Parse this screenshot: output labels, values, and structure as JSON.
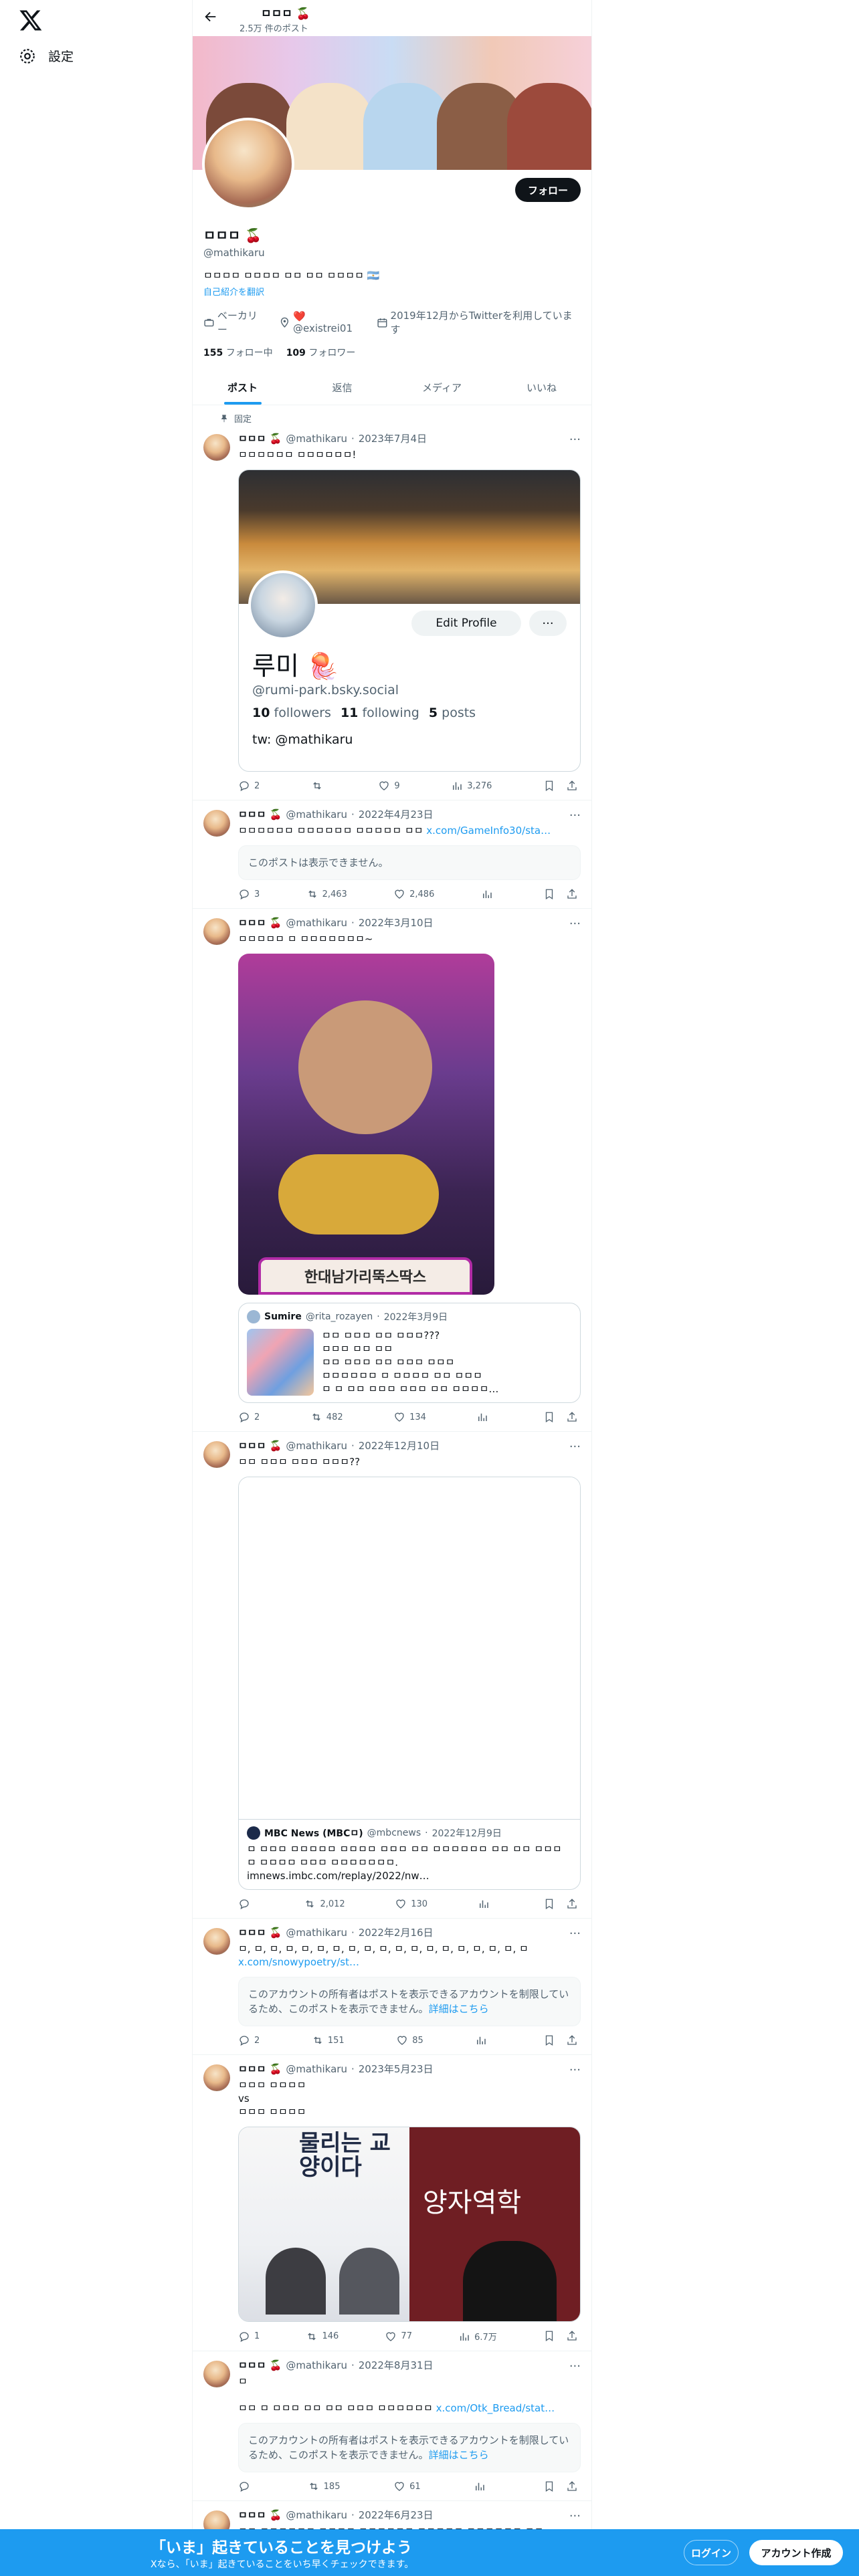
{
  "nav": {
    "settings_label": "設定"
  },
  "header": {
    "name": "ㅁㅁㅁ 🍒",
    "post_count": "2.5万 件のポスト"
  },
  "profile": {
    "name": "ㅁㅁㅁ 🍒",
    "handle": "@mathikaru",
    "bio": "ㅁㅁㅁㅁ ㅁㅁㅁㅁ ㅁㅁ ㅁㅁ ㅁㅁㅁㅁ 🇦🇷",
    "translate": "自己紹介を翻訳",
    "location": "ベーカリー",
    "link": "❤️@existrei01",
    "joined": "2019年12月からTwitterを利用しています",
    "following_count": "155",
    "following_label": "フォロー中",
    "followers_count": "109",
    "followers_label": "フォロワー",
    "follow_button": "フォロー"
  },
  "tabs": [
    "ポスト",
    "返信",
    "メディア",
    "いいね"
  ],
  "pinned_label": "固定",
  "tweets": [
    {
      "name": "ㅁㅁㅁ 🍒",
      "handle": "@mathikaru",
      "date": "2023年7月4日",
      "text": "ㅁㅁㅁㅁㅁㅁ ㅁㅁㅁㅁㅁㅁ!",
      "card": {
        "button": "Edit Profile",
        "name": "루미 🪼",
        "handle": "@rumi-park.bsky.social",
        "followers": "10",
        "followers_label": "followers",
        "following": "11",
        "following_label": "following",
        "posts": "5",
        "posts_label": "posts",
        "bio": "tw: @mathikaru"
      },
      "replies": "2",
      "retweets": "",
      "likes": "9",
      "views": "3,276"
    },
    {
      "name": "ㅁㅁㅁ 🍒",
      "handle": "@mathikaru",
      "date": "2022年4月23日",
      "text": "ㅁㅁㅁㅁㅁㅁ ㅁㅁㅁㅁㅁㅁ ㅁㅁㅁㅁㅁ ㅁㅁ ",
      "link": "x.com/GameInfo30/sta…",
      "unavailable": "このポストは表示できません。",
      "replies": "3",
      "retweets": "2,463",
      "likes": "2,486",
      "views": ""
    },
    {
      "name": "ㅁㅁㅁ 🍒",
      "handle": "@mathikaru",
      "date": "2022年3月10日",
      "text": "ㅁㅁㅁㅁㅁ ㅁ ㅁㅁㅁㅁㅁㅁㅁ~",
      "image_caption": "한대남가리뚝스딱스",
      "quote": {
        "name": "Sumire",
        "handle": "@rita_rozayen",
        "date": "2022年3月9日",
        "text": "ㅁㅁ ㅁㅁㅁ ㅁㅁ ㅁㅁㅁ???\nㅁㅁㅁ ㅁㅁ ㅁㅁ\nㅁㅁ ㅁㅁㅁ ㅁㅁ ㅁㅁㅁ ㅁㅁㅁ\nㅁㅁㅁㅁㅁㅁ ㅁ ㅁㅁㅁㅁ ㅁㅁ ㅁㅁㅁ\nㅁ ㅁ ㅁㅁ ㅁㅁㅁ ㅁㅁㅁ ㅁㅁ ㅁㅁㅁㅁ…"
      },
      "replies": "2",
      "retweets": "482",
      "likes": "134",
      "views": ""
    },
    {
      "name": "ㅁㅁㅁ 🍒",
      "handle": "@mathikaru",
      "date": "2022年12月10日",
      "text": "ㅁㅁ ㅁㅁㅁ ㅁㅁㅁ ㅁㅁㅁ??",
      "quote": {
        "name": "MBC News (MBCㅁ)",
        "handle": "@mbcnews",
        "date": "2022年12月9日",
        "text": "ㅁ ㅁㅁㅁ ㅁㅁㅁㅁㅁ ㅁㅁㅁㅁ ㅁㅁㅁ ㅁㅁ ㅁㅁㅁㅁㅁㅁ ㅁㅁ ㅁㅁ ㅁㅁㅁ\nㅁ ㅁㅁㅁㅁ ㅁㅁㅁ ㅁㅁㅁㅁㅁㅁㅁ.\nimnews.imbc.com/replay/2022/nw…"
      },
      "replies": "",
      "retweets": "2,012",
      "likes": "130",
      "views": ""
    },
    {
      "name": "ㅁㅁㅁ 🍒",
      "handle": "@mathikaru",
      "date": "2022年2月16日",
      "text": "ㅁ, ㅁ, ㅁ, ㅁ, ㅁ, ㅁ, ㅁ, ㅁ, ㅁ, ㅁ, ㅁ, ㅁ, ㅁ, ㅁ, ㅁ, ㅁ, ㅁ, ㅁ, ㅁ",
      "link": "x.com/snowypoetry/st…",
      "unavailable": "このアカウントの所有者はポストを表示できるアカウントを制限しているため、このポストを表示できません。",
      "detail_link": "詳細はこちら",
      "replies": "2",
      "retweets": "151",
      "likes": "85",
      "views": ""
    },
    {
      "name": "ㅁㅁㅁ 🍒",
      "handle": "@mathikaru",
      "date": "2023年5月23日",
      "text": "ㅁㅁㅁ ㅁㅁㅁㅁ\nvs\nㅁㅁㅁ ㅁㅁㅁㅁ",
      "img_left": "물리는 교양이다",
      "img_right": "양자역학",
      "replies": "1",
      "retweets": "146",
      "likes": "77",
      "views": "6.7万"
    },
    {
      "name": "ㅁㅁㅁ 🍒",
      "handle": "@mathikaru",
      "date": "2022年8月31日",
      "text": "ㅁ\n\nㅁㅁ ㅁ ㅁㅁㅁ ㅁㅁ ㅁㅁ ㅁㅁㅁ ㅁㅁㅁㅁㅁㅁ ",
      "link": "x.com/Otk_Bread/stat…",
      "unavailable": "このアカウントの所有者はポストを表示できるアカウントを制限しているため、このポストを表示できません。",
      "detail_link": "詳細はこちら",
      "replies": "",
      "retweets": "185",
      "likes": "61",
      "views": ""
    },
    {
      "name": "ㅁㅁㅁ 🍒",
      "handle": "@mathikaru",
      "date": "2022年6月23日",
      "text": "ㅁㅁ ㅁㅁㅁㅁㅁㅁ ㅁㅁㅁㅁ ㅁㅁㅁㅁㅁㅁ ㅁㅁㅁㅁㅁ ㅁㅁㅁㅁㅁㅁ ㅁㅁ"
    }
  ],
  "bottom_bar": {
    "title": "「いま」起きていることを見つけよう",
    "subtitle": "Xなら、「いま」起きていることをいち早くチェックできます。",
    "login": "ログイン",
    "signup": "アカウント作成"
  }
}
